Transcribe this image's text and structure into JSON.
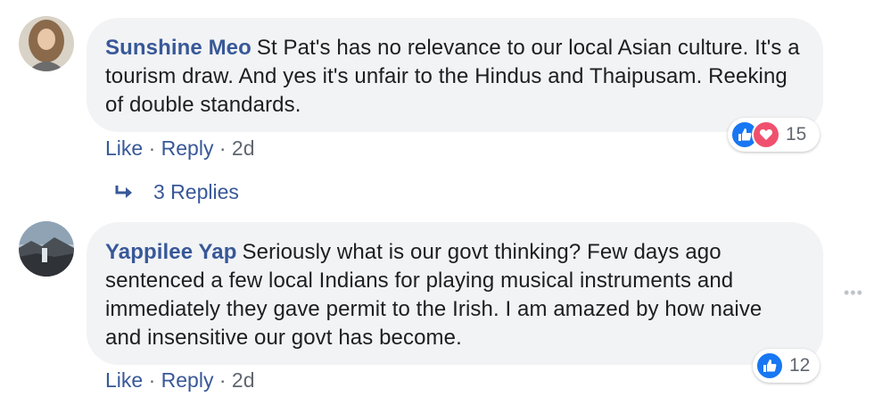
{
  "comments": [
    {
      "author": "Sunshine Meo",
      "text": "St Pat's has no relevance to our local Asian culture. It's a tourism draw. And yes it's unfair to the Hindus and Thaipusam. Reeking of double standards.",
      "actions": {
        "like": "Like",
        "reply": "Reply",
        "sep": "·",
        "time": "2d"
      },
      "reactions": {
        "icons": [
          "like-icon",
          "love-icon"
        ],
        "count": "15"
      },
      "replies": {
        "label": "3 Replies",
        "icon": "reply-arrow-icon"
      }
    },
    {
      "author": "Yappilee Yap",
      "text": "Seriously what is our govt thinking? Few days ago sentenced a few local Indians for playing musical instruments and immediately they gave permit to the Irish. I am amazed by how naive and insensitive our govt has become.",
      "actions": {
        "like": "Like",
        "reply": "Reply",
        "sep": "·",
        "time": "2d"
      },
      "reactions": {
        "icons": [
          "like-icon"
        ],
        "count": "12"
      }
    }
  ],
  "more_options": "•••",
  "colors": {
    "link": "#385898",
    "bubble": "#f2f3f5",
    "like": "#1877f2",
    "love": "#f0506e",
    "meta": "#616770"
  }
}
